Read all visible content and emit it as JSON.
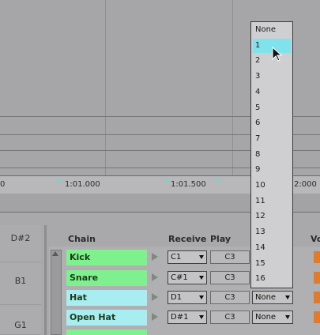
{
  "ruler": {
    "ticks": [
      "0",
      "1:01.000",
      "1:01.500",
      "2:000"
    ]
  },
  "pad_names": [
    "D#2",
    "B1",
    "G1"
  ],
  "chain_header": {
    "chain": "Chain",
    "receive": "Receive",
    "play": "Play",
    "vol": "Vo"
  },
  "chains": [
    {
      "name": "Kick",
      "receive": "C1",
      "play": "C3",
      "choke": "",
      "color": "#7ef08e"
    },
    {
      "name": "Snare",
      "receive": "C#1",
      "play": "C3",
      "choke": "",
      "color": "#7ef08e"
    },
    {
      "name": "Hat",
      "receive": "D1",
      "play": "C3",
      "choke": "None",
      "color": "#a8eef0"
    },
    {
      "name": "Open Hat",
      "receive": "D#1",
      "play": "C3",
      "choke": "None",
      "color": "#a8eef0"
    }
  ],
  "choke_dropdown": {
    "options": [
      "None",
      "1",
      "2",
      "3",
      "4",
      "5",
      "6",
      "7",
      "8",
      "9",
      "10",
      "11",
      "12",
      "13",
      "14",
      "15",
      "16"
    ],
    "selected": "1"
  },
  "colors": {
    "selected_highlight": "#7ee3ec",
    "chain_green": "#7ef08e",
    "chain_cyan": "#a8eef0",
    "volume_orange": "#e07a2c"
  }
}
